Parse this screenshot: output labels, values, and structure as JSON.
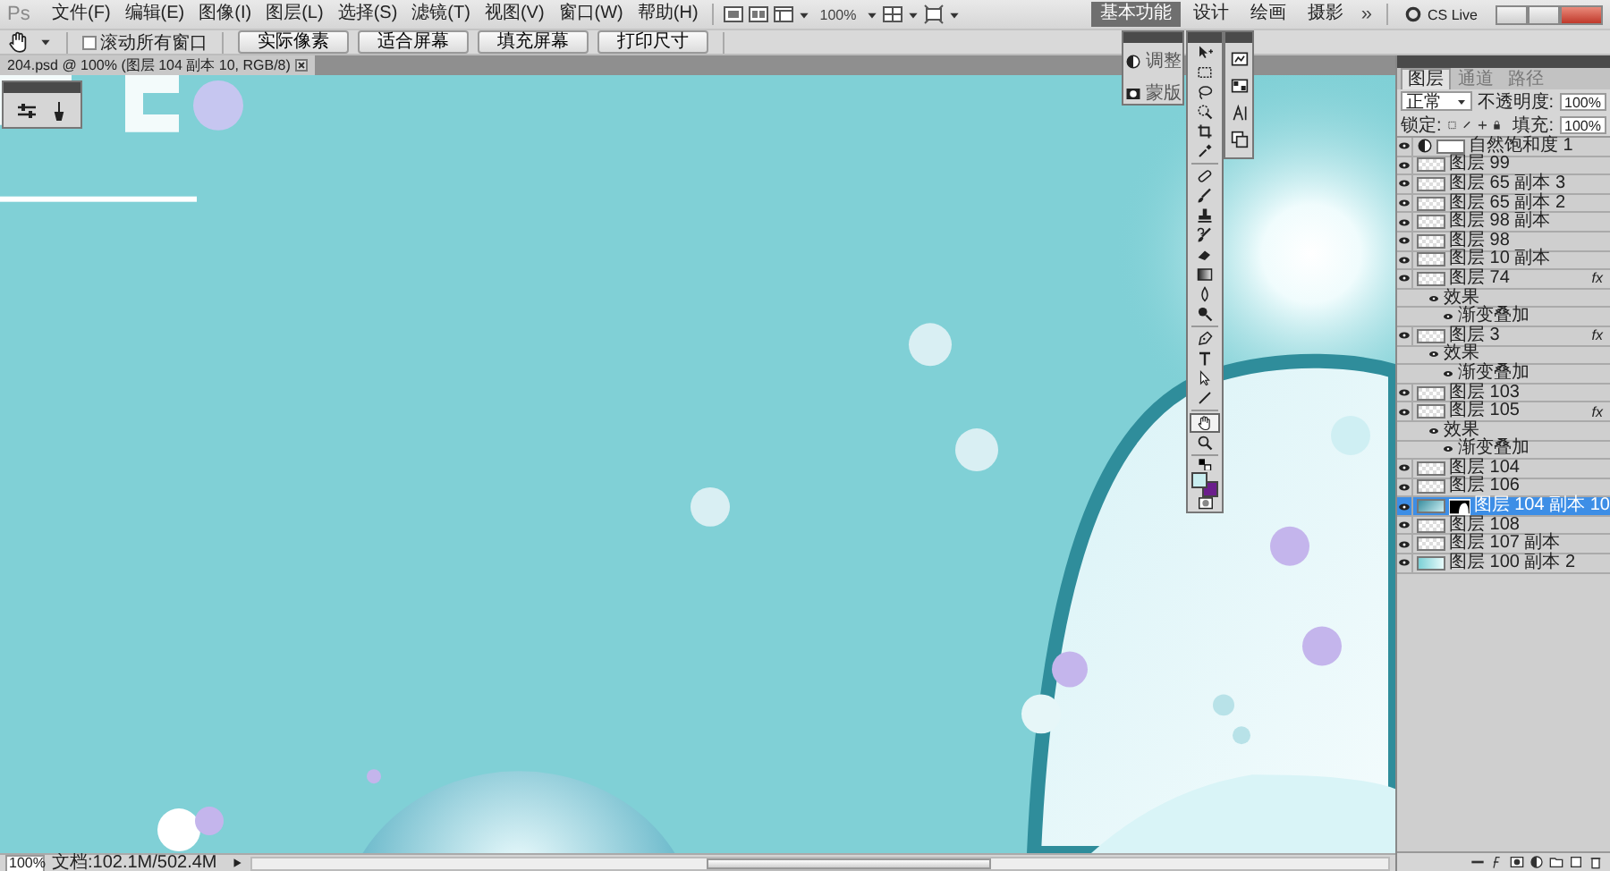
{
  "app": {
    "logo": "Ps"
  },
  "menu": [
    {
      "label": "文件(F)"
    },
    {
      "label": "编辑(E)"
    },
    {
      "label": "图像(I)"
    },
    {
      "label": "图层(L)"
    },
    {
      "label": "选择(S)"
    },
    {
      "label": "滤镜(T)"
    },
    {
      "label": "视图(V)"
    },
    {
      "label": "窗口(W)"
    },
    {
      "label": "帮助(H)"
    }
  ],
  "zoom_menu": "100%",
  "workspaces": [
    {
      "label": "基本功能",
      "selected": true
    },
    {
      "label": "设计",
      "selected": false
    },
    {
      "label": "绘画",
      "selected": false
    },
    {
      "label": "摄影",
      "selected": false
    }
  ],
  "more": "»",
  "cs_live": "CS Live",
  "options": {
    "scroll_all": {
      "label": "滚动所有窗口",
      "checked": false
    },
    "buttons": [
      "实际像素",
      "适合屏幕",
      "填充屏幕",
      "打印尺寸"
    ]
  },
  "document": {
    "tab": "204.psd @ 100% (图层 104 副本 10, RGB/8)"
  },
  "adjust_panel": {
    "items": [
      {
        "kind": "adjustments",
        "label": "调整"
      },
      {
        "kind": "masks",
        "label": "蒙版"
      }
    ]
  },
  "tools": [
    {
      "kind": "move",
      "selected": false
    },
    {
      "kind": "marquee",
      "selected": false
    },
    {
      "kind": "lasso",
      "selected": false
    },
    {
      "kind": "quick-select",
      "selected": false
    },
    {
      "kind": "crop",
      "selected": false
    },
    {
      "kind": "eyedropper",
      "selected": false
    },
    {
      "kind": "healing",
      "selected": false
    },
    {
      "kind": "brush",
      "selected": false
    },
    {
      "kind": "stamp",
      "selected": false
    },
    {
      "kind": "history-brush",
      "selected": false
    },
    {
      "kind": "eraser",
      "selected": false
    },
    {
      "kind": "gradient",
      "selected": false
    },
    {
      "kind": "blur",
      "selected": false
    },
    {
      "kind": "dodge",
      "selected": false
    },
    {
      "kind": "pen",
      "selected": false
    },
    {
      "kind": "type",
      "selected": false
    },
    {
      "kind": "path-select",
      "selected": false
    },
    {
      "kind": "line",
      "selected": false
    },
    {
      "kind": "hand",
      "selected": true
    },
    {
      "kind": "zoom",
      "selected": false
    }
  ],
  "swatches": [
    {
      "kind": "foreground",
      "color": "#c9eef0"
    },
    {
      "kind": "background",
      "color": "#6b1e8c"
    }
  ],
  "layers_panel": {
    "tabs": [
      {
        "label": "图层",
        "selected": true
      },
      {
        "label": "通道",
        "selected": false
      },
      {
        "label": "路径",
        "selected": false
      }
    ],
    "blend_mode": "正常",
    "opacity_label": "不透明度:",
    "opacity": "100%",
    "lock_label": "锁定:",
    "fill_label": "填充:",
    "fill": "100%",
    "layers": [
      {
        "name": "自然饱和度 1",
        "kind": "adjustment",
        "visible": true,
        "selected": false
      },
      {
        "name": "图层 99",
        "kind": "transparent",
        "visible": true,
        "selected": false
      },
      {
        "name": "图层 65 副本 3",
        "kind": "transparent",
        "visible": true,
        "selected": false
      },
      {
        "name": "图层 65 副本 2",
        "kind": "transparent",
        "visible": true,
        "selected": false
      },
      {
        "name": "图层 98 副本",
        "kind": "transparent",
        "visible": true,
        "selected": false
      },
      {
        "name": "图层 98",
        "kind": "transparent",
        "visible": true,
        "selected": false
      },
      {
        "name": "图层 10 副本",
        "kind": "transparent",
        "visible": true,
        "selected": false
      },
      {
        "name": "图层 74",
        "kind": "transparent",
        "visible": true,
        "selected": false,
        "badge": "fx",
        "children": [
          {
            "name": "效果",
            "visible": true,
            "children": [
              {
                "name": "渐变叠加",
                "visible": true
              }
            ]
          }
        ]
      },
      {
        "name": "图层 3",
        "kind": "transparent",
        "visible": true,
        "selected": false,
        "badge": "fx",
        "children": [
          {
            "name": "效果",
            "visible": true,
            "children": [
              {
                "name": "渐变叠加",
                "visible": true
              }
            ]
          }
        ]
      },
      {
        "name": "图层 103",
        "kind": "transparent",
        "visible": true,
        "selected": false
      },
      {
        "name": "图层 105",
        "kind": "transparent",
        "visible": true,
        "selected": false,
        "badge": "fx",
        "children": [
          {
            "name": "效果",
            "visible": true,
            "children": [
              {
                "name": "渐变叠加",
                "visible": true
              }
            ]
          }
        ]
      },
      {
        "name": "图层 104",
        "kind": "transparent",
        "visible": true,
        "selected": false
      },
      {
        "name": "图层 106",
        "kind": "transparent",
        "visible": true,
        "selected": false
      },
      {
        "name": "图层 104 副本 10",
        "kind": "masked",
        "visible": true,
        "selected": true
      },
      {
        "name": "图层 108",
        "kind": "transparent",
        "visible": true,
        "selected": false
      },
      {
        "name": "图层 107 副本",
        "kind": "transparent",
        "visible": true,
        "selected": false
      },
      {
        "name": "图层 100 副本 2",
        "kind": "gradient",
        "visible": true,
        "selected": false
      }
    ]
  },
  "status_bar": {
    "zoom": "100%",
    "doc_info": "文档:102.1M/502.4M"
  }
}
